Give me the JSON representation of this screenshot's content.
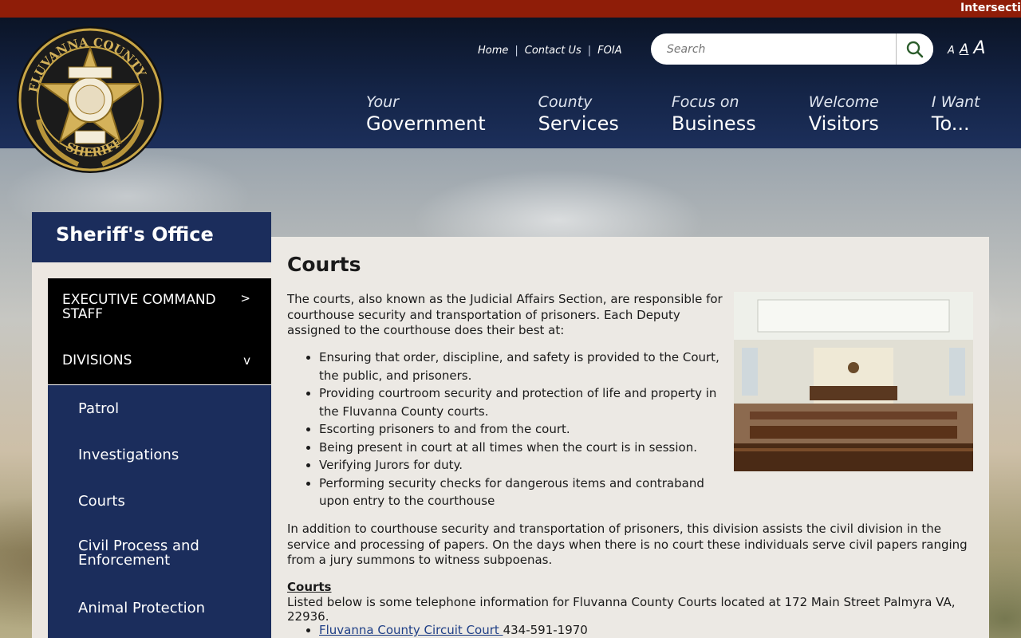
{
  "ticker": {
    "text": "Intersection"
  },
  "logo": {
    "alt": "Fluvanna County Sheriff VA seal"
  },
  "utility": {
    "links": [
      "Home",
      "Contact Us",
      "FOIA"
    ],
    "separator": "|"
  },
  "search": {
    "placeholder": "Search"
  },
  "fontsize": {
    "small": "A",
    "medium": "A",
    "large": "A"
  },
  "nav": [
    {
      "small": "Your",
      "big": "Government"
    },
    {
      "small": "County",
      "big": "Services"
    },
    {
      "small": "Focus on",
      "big": "Business"
    },
    {
      "small": "Welcome",
      "big": "Visitors"
    },
    {
      "small": "I Want",
      "big": "To..."
    }
  ],
  "sidebar": {
    "title": "Sheriff's Office",
    "items": [
      {
        "label": "EXECUTIVE COMMAND STAFF",
        "arrow": ">"
      },
      {
        "label": "DIVISIONS",
        "arrow": "v"
      }
    ],
    "subitems": [
      "Patrol",
      "Investigations",
      "Courts",
      "Civil Process and Enforcement",
      "Animal Protection"
    ]
  },
  "content": {
    "title": "Courts",
    "intro": "The courts, also known as the Judicial Affairs Section, are responsible for courthouse security and transportation of prisoners.  Each Deputy assigned to the courthouse does their best at:",
    "duties": [
      "Ensuring that order, discipline, and safety is provided to the Court, the public, and prisoners.",
      "Providing courtroom security and protection of life and property in the Fluvanna County courts.",
      "Escorting prisoners to and from the court.",
      "Being present in court at all times when the court is in session.",
      "Verifying Jurors for duty.",
      "Performing security checks for dangerous items and contraband upon entry to the courthouse"
    ],
    "additional": "In addition to courthouse security and transportation of prisoners, this division assists the civil division in the service and processing of papers.  On the days when there is no court these individuals serve civil papers ranging from a jury summons to witness subpoenas.",
    "courts_heading": "Courts",
    "courts_text": "Listed below is some telephone information for Fluvanna County Courts located at 172 Main Street Palmyra VA, 22936.",
    "phones": [
      {
        "name": "Fluvanna County Circuit Court ",
        "number": "434-591-1970"
      }
    ]
  },
  "colors": {
    "topbar": "#8f1d08",
    "header": "#142446",
    "sidebar": "#1b2d5c",
    "content_bg": "#ece9e4",
    "link": "#1f3f86"
  },
  "icons": [
    "search-icon",
    "chevron-right-icon",
    "chevron-down-icon"
  ]
}
